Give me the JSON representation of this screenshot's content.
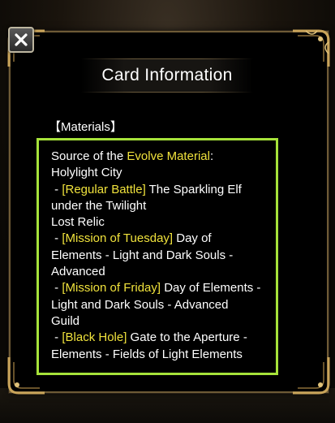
{
  "dialog": {
    "title": "Card Information",
    "section_label": "【Materials】"
  },
  "materials": {
    "source_prefix": "Source of the ",
    "source_highlight": "Evolve Material",
    "source_suffix": ":",
    "location_1": "Holylight City",
    "entry_1_dash": " - ",
    "entry_1_tag": "[Regular Battle]",
    "entry_1_text": " The Sparkling Elf",
    "entry_1_text_2": "under the Twilight",
    "location_2": "Lost Relic",
    "entry_2_dash": " - ",
    "entry_2_tag": "[Mission of Tuesday]",
    "entry_2_text": " Day of",
    "entry_2_text_2": "Elements - Light and Dark Souls -",
    "entry_2_text_3": "Advanced",
    "entry_3_dash": " - ",
    "entry_3_tag": "[Mission of Friday]",
    "entry_3_text": " Day of Elements -",
    "entry_3_text_2": "Light and Dark Souls - Advanced",
    "entry_3_text_3": "Guild",
    "entry_4_dash": " - ",
    "entry_4_tag": "[Black Hole]",
    "entry_4_text": " Gate to the Aperture -",
    "entry_4_text_2": "Elements - Fields of Light Elements"
  },
  "colors": {
    "highlight": "#f0e23c",
    "box_border": "#a6e23a",
    "frame_gold": "#c9a45a"
  },
  "icons": {
    "close": "close-icon",
    "corner": "ornament-corner-icon"
  }
}
